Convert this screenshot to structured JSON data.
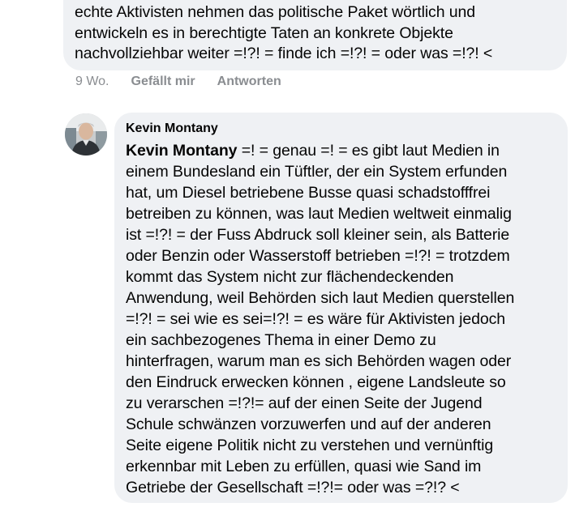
{
  "previous_comment": {
    "text": "echte Aktivisten nehmen das politische Paket wörtlich und\nentwickeln es in berechtigte Taten an konkrete Objekte\nnachvollziehbar weiter =!?! = finde ich =!?! = oder was =!?! <",
    "time": "9 Wo.",
    "like_label": "Gefällt mir",
    "reply_label": "Antworten"
  },
  "comment": {
    "author": "Kevin Montany",
    "mention": "Kevin Montany",
    "text": " =! = genau =! = es gibt laut Medien  in\neinem Bundesland ein Tüftler, der ein System erfunden\nhat, um Diesel betriebene Busse quasi schadstofffrei\nbetreiben zu können, was laut Medien weltweit einmalig\nist =!?! = der Fuss Abdruck soll  kleiner sein, als Batterie\noder Benzin oder Wasserstoff betrieben =!?! = trotzdem\nkommt das System nicht zur flächendeckenden\nAnwendung, weil Behörden sich laut Medien querstellen\n=!?! = sei wie es sei=!?! = es wäre für Aktivisten jedoch\nein sachbezogenes Thema in einer Demo zu\nhinterfragen, warum man es sich Behörden wagen oder\nden Eindruck erwecken können , eigene Landsleute so\nzu verarschen =!?!= auf der einen Seite der Jugend\nSchule schwänzen vorzuwerfen und auf der anderen\nSeite  eigene Politik nicht zu verstehen und vernünftig\nerkennbar mit Leben zu erfüllen, quasi wie Sand im\nGetriebe der Gesellschaft =!?!= oder was =?!? <"
  }
}
